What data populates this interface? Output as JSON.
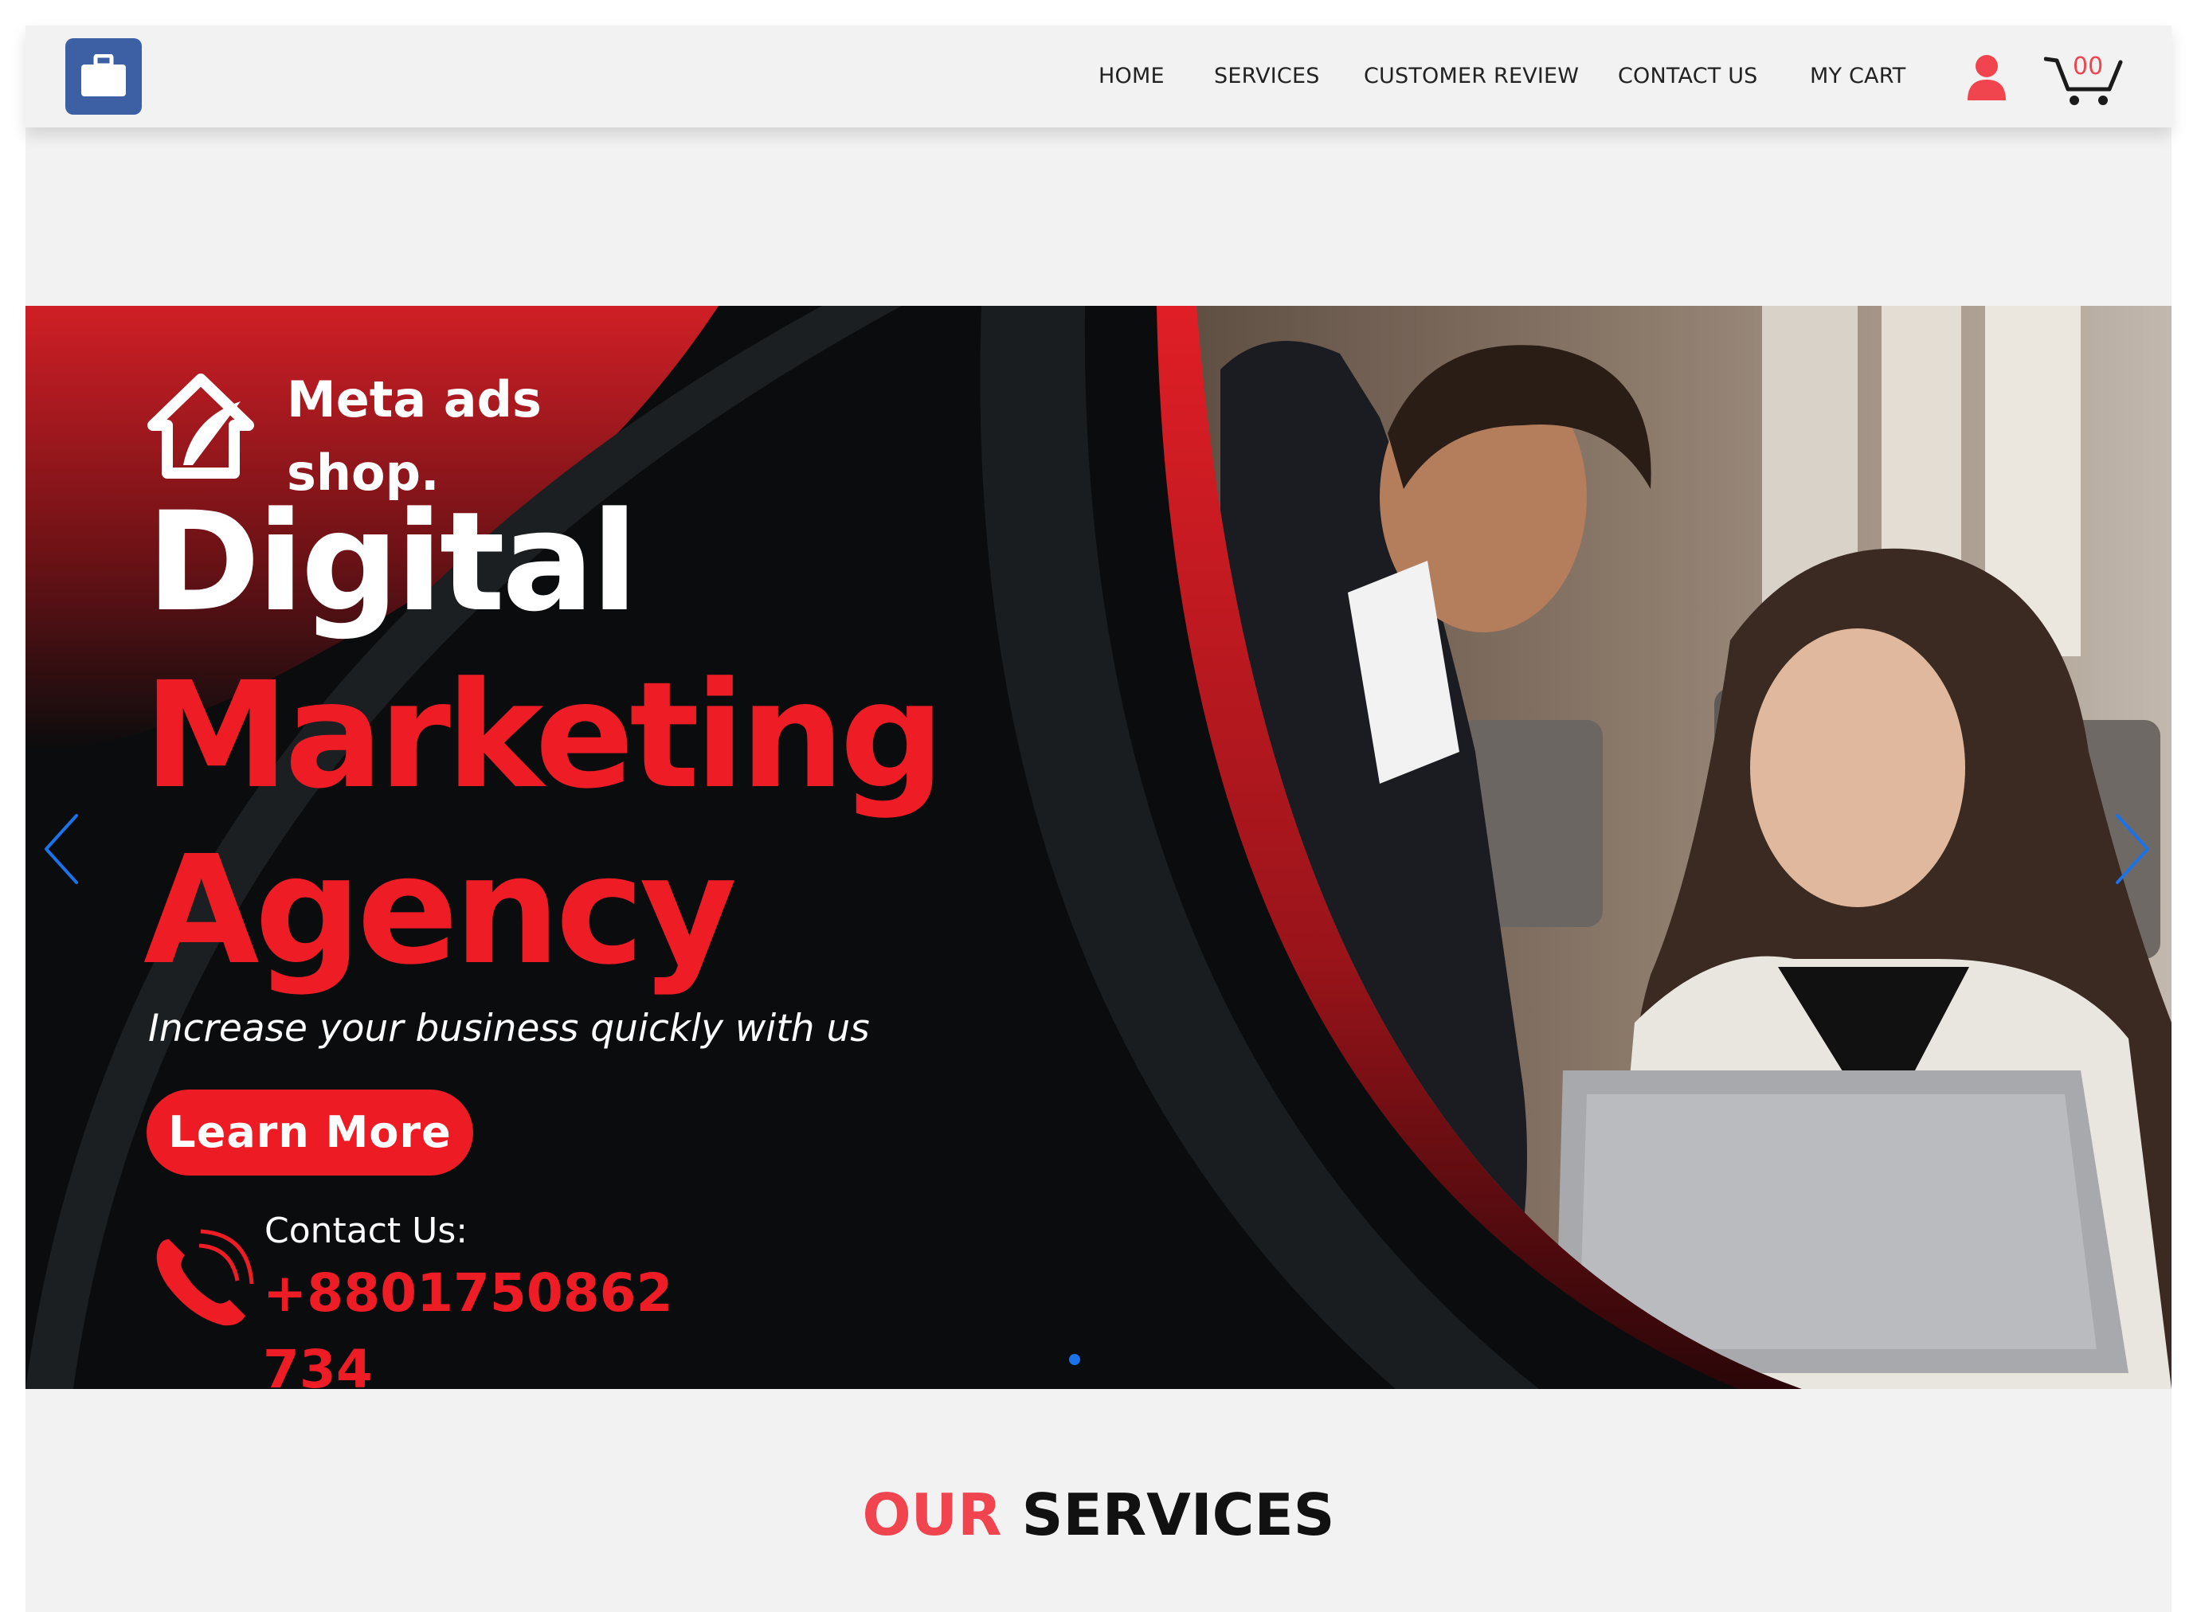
{
  "navbar": {
    "logo_icon": "briefcase-icon",
    "links": [
      {
        "label": "HOME"
      },
      {
        "label": "SERVICES"
      },
      {
        "label": "CUSTOMER REVIEW"
      },
      {
        "label": "CONTACT US"
      },
      {
        "label": "MY CART"
      }
    ],
    "user_icon": "user-icon",
    "cart_icon": "cart-icon",
    "cart_count": "00"
  },
  "hero": {
    "brand_line1": "Meta ads",
    "brand_line2": "shop.",
    "headline_1": "Digital",
    "headline_2": "Marketing",
    "headline_3": "Agency",
    "tagline": "Increase your business quickly with us",
    "cta_label": "Learn More",
    "contact_label": "Contact Us:",
    "contact_phone": "+8801750862734",
    "prev_icon": "chevron-left-icon",
    "next_icon": "chevron-right-icon",
    "slide_count": 1,
    "active_slide": 1
  },
  "services_heading": {
    "accent": "OUR",
    "main": "SERVICES"
  },
  "colors": {
    "accent_red": "#ee1c25",
    "heading_accent": "#f0454f",
    "logo_blue": "#3d5fa4",
    "slider_control_blue": "#1a73e8",
    "background": "#f2f2f2"
  }
}
